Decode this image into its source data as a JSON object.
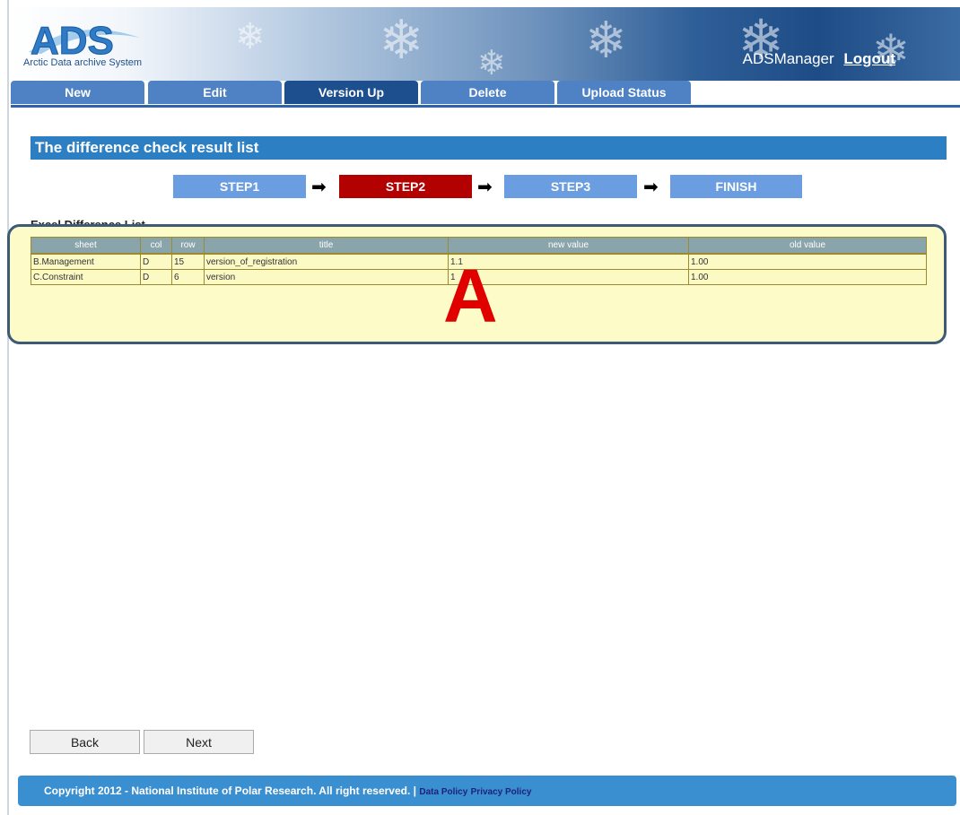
{
  "app": {
    "logo_text": "ADS",
    "logo_subtitle": "Arctic Data archive System",
    "username": "ADSManager",
    "logout_label": "Logout"
  },
  "tabs": [
    {
      "label": "New"
    },
    {
      "label": "Edit"
    },
    {
      "label": "Version Up",
      "active": true
    },
    {
      "label": "Delete"
    },
    {
      "label": "Upload Status"
    }
  ],
  "page_title": "The difference check result list",
  "steps": [
    {
      "label": "STEP1"
    },
    {
      "label": "STEP2",
      "active": true
    },
    {
      "label": "STEP3"
    },
    {
      "label": "FINISH"
    }
  ],
  "section_label": "Excel Difference List",
  "table": {
    "headers": [
      "sheet",
      "col",
      "row",
      "title",
      "new value",
      "old value"
    ],
    "rows": [
      [
        "B.Management",
        "D",
        "15",
        "version_of_registration",
        "1.1",
        "1.00"
      ],
      [
        "C.Constraint",
        "D",
        "6",
        "version",
        "1",
        "1.00"
      ]
    ]
  },
  "annotation_label": "A",
  "buttons": {
    "back": "Back",
    "next": "Next"
  },
  "footer": {
    "copyright": "Copyright 2012 - National Institute of Polar Research. All right reserved.",
    "separator": "|",
    "data_policy": "Data Policy",
    "privacy_policy": "Privacy Policy"
  },
  "colors": {
    "tab_blue": "#4f82c4",
    "tab_active": "#1d4f8e",
    "title_bar": "#2d7fc4",
    "step_blue": "#6b9ee0",
    "step_active": "#b30000",
    "highlight_bg": "#fdfcc8",
    "annotation_red": "#e10000"
  }
}
